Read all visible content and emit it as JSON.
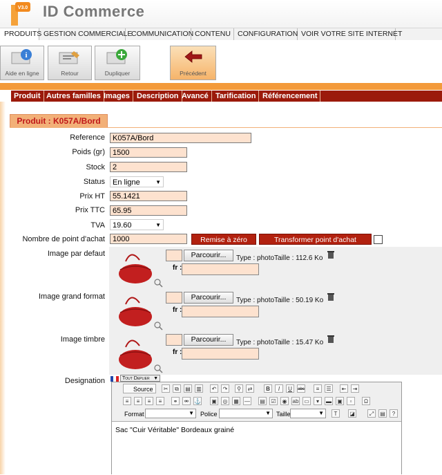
{
  "app": {
    "logo_text": "ID Commerce",
    "logo_version": "V3.0"
  },
  "menu": [
    "PRODUITS",
    "GESTION COMMERCIALE",
    "COMMUNICATION",
    "CONTENU",
    "CONFIGURATION",
    "VOIR VOTRE SITE INTERNET"
  ],
  "toolbar": {
    "help": "Aide en ligne",
    "back": "Retour",
    "duplicate": "Dupliquer",
    "previous": "Précédent"
  },
  "tabs": [
    "Produit",
    "Autres familles",
    "Images",
    "Description",
    "Avancé",
    "Tarification",
    "Référencement"
  ],
  "product_title": "Produit : K057A/Bord",
  "form": {
    "reference": {
      "label": "Reference",
      "value": "K057A/Bord"
    },
    "weight": {
      "label": "Poids (gr)",
      "value": "1500"
    },
    "stock": {
      "label": "Stock",
      "value": "2"
    },
    "status": {
      "label": "Status",
      "value": "En ligne"
    },
    "price_ht": {
      "label": "Prix HT",
      "value": "55.1421"
    },
    "price_ttc": {
      "label": "Prix TTC",
      "value": "65.95"
    },
    "tva": {
      "label": "TVA",
      "value": "19.60"
    },
    "points": {
      "label": "Nombre de point d'achat",
      "value": "1000",
      "reset": "Remise à zéro",
      "transform": "Transformer point d'achat"
    }
  },
  "images": [
    {
      "label": "Image par defaut",
      "browse": "Parcourir...",
      "type": "Type : photo",
      "size": "Taille : 112.6 Ko",
      "fr": "fr :"
    },
    {
      "label": "Image grand format",
      "browse": "Parcourir...",
      "type": "Type : photo",
      "size": "Taille : 50.19 Ko",
      "fr": "fr :"
    },
    {
      "label": "Image timbre",
      "browse": "Parcourir...",
      "type": "Type : photo",
      "size": "Taille : 15.47 Ko",
      "fr": "fr :"
    }
  ],
  "designation": {
    "label": "Designation",
    "lang_button": "Tout Deplier",
    "source": "Source",
    "format": "Format",
    "police": "Police",
    "taille": "Taille",
    "content": "Sac \"Cuir Véritable\" Bordeaux grainé"
  },
  "colors": {
    "accent_orange": "#f39a3a",
    "tab_red": "#9b1a0b",
    "button_red": "#b2210f",
    "input_bg": "#fde2cf"
  }
}
